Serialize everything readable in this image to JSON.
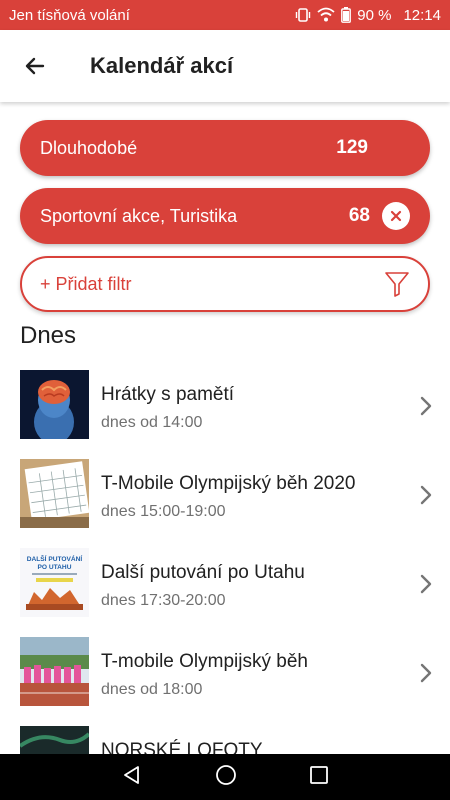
{
  "status_bar": {
    "carrier": "Jen tísňová volání",
    "battery": "90 %",
    "time": "12:14"
  },
  "app_bar": {
    "title": "Kalendář akcí",
    "back_icon": "arrow-left-icon"
  },
  "filters": [
    {
      "label": "Dlouhodobé",
      "count": "129",
      "removable": false
    },
    {
      "label": "Sportovní akce, Turistika",
      "count": "68",
      "removable": true
    }
  ],
  "add_filter": {
    "label": "+ Přidat filtr",
    "icon": "funnel-icon"
  },
  "section": {
    "title": "Dnes"
  },
  "events": [
    {
      "title": "Hrátky s pamětí",
      "time": "dnes od 14:00"
    },
    {
      "title": "T-Mobile Olympijský běh 2020",
      "time": "dnes 15:00-19:00"
    },
    {
      "title": "Další putování po Utahu",
      "time": "dnes 17:30-20:00"
    },
    {
      "title": "T-mobile Olympijský běh",
      "time": "dnes od 18:00"
    },
    {
      "title": "NORSKÉ LOFOTY",
      "time": ""
    }
  ],
  "thumbnail_texts": {
    "poster_line1": "DALŠÍ PUTOVÁNÍ",
    "poster_line2": "PO UTAHU"
  },
  "colors": {
    "accent": "#d9413a",
    "text": "#212121",
    "secondary_text": "#707070"
  }
}
